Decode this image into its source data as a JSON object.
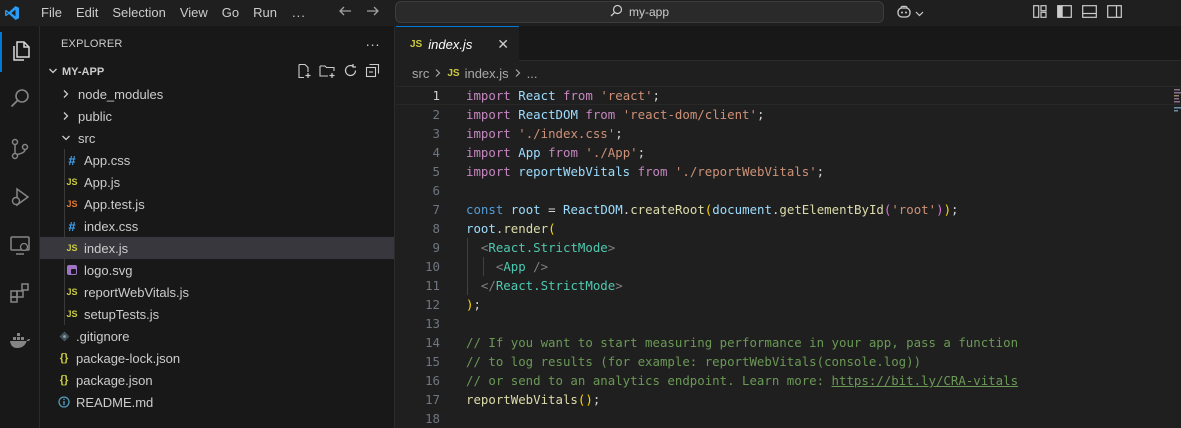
{
  "menu": [
    "File",
    "Edit",
    "Selection",
    "View",
    "Go",
    "Run",
    "..."
  ],
  "search": {
    "text": "my-app"
  },
  "explorer": {
    "title": "EXPLORER",
    "more": "···",
    "project": "MY-APP",
    "items": [
      {
        "label": "node_modules",
        "icon": "chevron-right-icon"
      },
      {
        "label": "public",
        "icon": "chevron-right-icon"
      },
      {
        "label": "src",
        "icon": "chevron-down-icon"
      },
      {
        "label": "App.css",
        "icon": "css-file-icon",
        "glyph": "#"
      },
      {
        "label": "App.js",
        "icon": "js-file-icon",
        "glyph": "JS"
      },
      {
        "label": "App.test.js",
        "icon": "test-file-icon",
        "glyph": "JS"
      },
      {
        "label": "index.css",
        "icon": "css-file-icon",
        "glyph": "#"
      },
      {
        "label": "index.js",
        "icon": "js-file-icon",
        "glyph": "JS"
      },
      {
        "label": "logo.svg",
        "icon": "svg-file-icon"
      },
      {
        "label": "reportWebVitals.js",
        "icon": "js-file-icon",
        "glyph": "JS"
      },
      {
        "label": "setupTests.js",
        "icon": "js-file-icon",
        "glyph": "JS"
      },
      {
        "label": ".gitignore",
        "icon": "git-file-icon"
      },
      {
        "label": "package-lock.json",
        "icon": "json-file-icon",
        "glyph": "{}"
      },
      {
        "label": "package.json",
        "icon": "json-file-icon",
        "glyph": "{}"
      },
      {
        "label": "README.md",
        "icon": "info-file-icon"
      }
    ]
  },
  "tab": {
    "label": "index.js",
    "close": "✕",
    "badge": "JS"
  },
  "breadcrumb": {
    "folder": "src",
    "file": "index.js",
    "ellipsis": "...",
    "badge": "JS"
  },
  "editor": {
    "line_numbers": [
      "1",
      "2",
      "3",
      "4",
      "5",
      "6",
      "7",
      "8",
      "9",
      "10",
      "11",
      "12",
      "13",
      "14",
      "15",
      "16",
      "17",
      "18"
    ],
    "code": {
      "l1_kw": "import",
      "l1_id": "React",
      "l1_from": "from",
      "l1_str": "'react'",
      "l1_end": ";",
      "l2_kw": "import",
      "l2_id": "ReactDOM",
      "l2_from": "from",
      "l2_str": "'react-dom/client'",
      "l2_end": ";",
      "l3_kw": "import",
      "l3_str": "'./index.css'",
      "l3_end": ";",
      "l4_kw": "import",
      "l4_id": "App",
      "l4_from": "from",
      "l4_str": "'./App'",
      "l4_end": ";",
      "l5_kw": "import",
      "l5_id": "reportWebVitals",
      "l5_from": "from",
      "l5_str": "'./reportWebVitals'",
      "l5_end": ";",
      "l7_const": "const",
      "l7_root": "root",
      "l7_eq": "=",
      "l7_obj": "ReactDOM",
      "l7_dot": ".",
      "l7_fn": "createRoot",
      "l7_p1": "(",
      "l7_doc": "document",
      "l7_dot2": ".",
      "l7_fn2": "getElementById",
      "l7_p2": "(",
      "l7_str": "'root'",
      "l7_p3": ")",
      "l7_p4": ")",
      "l7_end": ";",
      "l8_root": "root",
      "l8_dot": ".",
      "l8_fn": "render",
      "l8_p": "(",
      "l9_open": "<",
      "l9_tag": "React.StrictMode",
      "l9_close": ">",
      "l10_open": "<",
      "l10_tag": "App",
      "l10_close": " />",
      "l11_open": "</",
      "l11_tag": "React.StrictMode",
      "l11_close": ">",
      "l12_p": ")",
      "l12_end": ";",
      "l14": "// If you want to start measuring performance in your app, pass a function",
      "l15": "// to log results (for example: reportWebVitals(console.log))",
      "l16_a": "// or send to an analytics endpoint. Learn more: ",
      "l16_link": "https://bit.ly/CRA-vitals",
      "l17_fn": "reportWebVitals",
      "l17_p": "()",
      "l17_end": ";"
    }
  },
  "colors": {
    "accent": "#0078d4",
    "js_badge": "#cbcb41"
  }
}
